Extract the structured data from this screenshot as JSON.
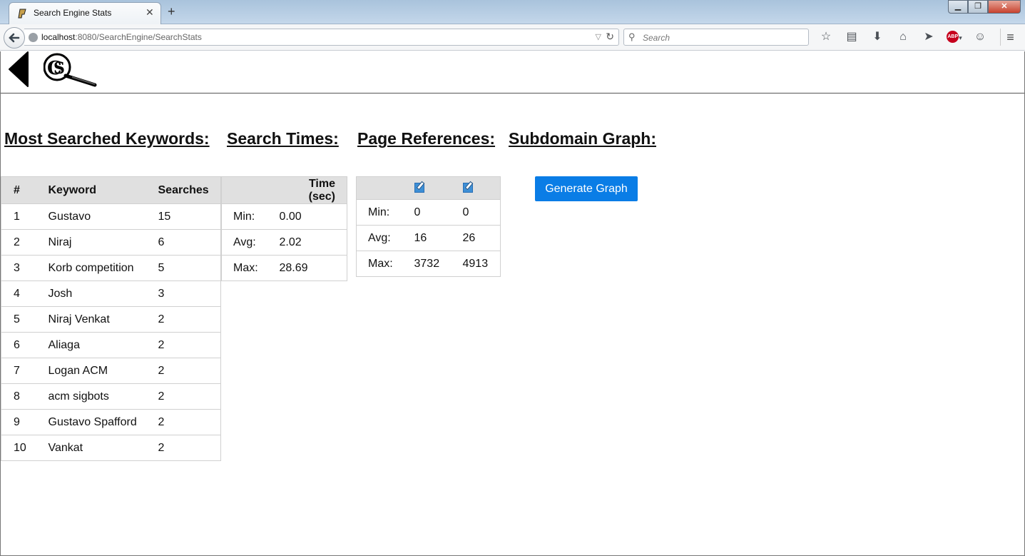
{
  "browser": {
    "tab_title": "Search Engine Stats",
    "url_host": "localhost",
    "url_path": ":8080/SearchEngine/SearchStats",
    "search_placeholder": "Search"
  },
  "headings": {
    "keywords": "Most Searched Keywords:",
    "times": "Search Times:",
    "references": "Page References:",
    "subdomain": "Subdomain Graph:"
  },
  "keywords_table": {
    "headers": [
      "#",
      "Keyword",
      "Searches"
    ],
    "rows": [
      [
        "1",
        "Gustavo",
        "15"
      ],
      [
        "2",
        "Niraj",
        "6"
      ],
      [
        "3",
        "Korb competition",
        "5"
      ],
      [
        "4",
        "Josh",
        "3"
      ],
      [
        "5",
        "Niraj Venkat",
        "2"
      ],
      [
        "6",
        "Aliaga",
        "2"
      ],
      [
        "7",
        "Logan ACM",
        "2"
      ],
      [
        "8",
        "acm sigbots",
        "2"
      ],
      [
        "9",
        "Gustavo Spafford",
        "2"
      ],
      [
        "10",
        "Vankat",
        "2"
      ]
    ]
  },
  "times_table": {
    "header": "Time (sec)",
    "rows": [
      [
        "Min:",
        "0.00"
      ],
      [
        "Avg:",
        "2.02"
      ],
      [
        "Max:",
        "28.69"
      ]
    ]
  },
  "references_table": {
    "rows": [
      [
        "Min:",
        "0",
        "0"
      ],
      [
        "Avg:",
        "16",
        "26"
      ],
      [
        "Max:",
        "3732",
        "4913"
      ]
    ]
  },
  "generate_button": "Generate Graph",
  "colors": {
    "button": "#0a7de6",
    "header_bg": "#e0e0e0"
  }
}
